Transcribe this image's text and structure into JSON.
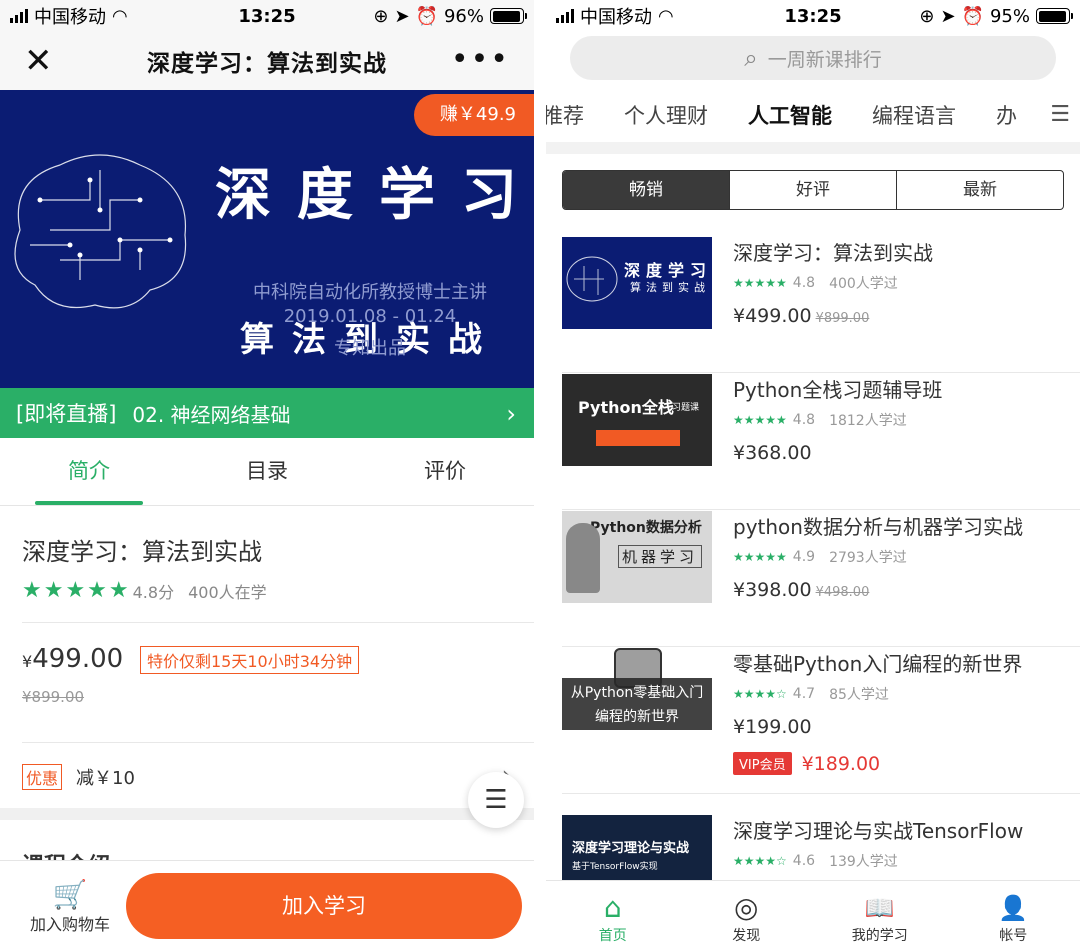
{
  "left": {
    "status": {
      "carrier": "中国移动",
      "time": "13:25",
      "battery": "96%",
      "battery_level": 0.96
    },
    "nav": {
      "close": "✕",
      "title": "深度学习：算法到实战",
      "more": "•••"
    },
    "banner": {
      "earn": "赚￥49.9",
      "title": "深度学习",
      "subtitle": "算法到实战",
      "line1": "中科院自动化所教授博士主讲",
      "line2": "2019.01.08 - 01.24",
      "line3": "专知出品"
    },
    "live": {
      "tag": "[即将直播]",
      "text": "02. 神经网络基础",
      "arrow": "›"
    },
    "tabs": [
      "简介",
      "目录",
      "评价"
    ],
    "info": {
      "title": "深度学习：算法到实战",
      "stars": "★★★★★",
      "score": "4.8分",
      "learners": "400人在学",
      "price_symbol": "¥",
      "price": "499.00",
      "limit": "特价仅剩15天10小时34分钟",
      "original": "¥899.00",
      "coupon_badge": "优惠",
      "coupon_text": "减￥10",
      "chevron": "›"
    },
    "intro_heading": "课程介绍",
    "fab_icon": "☰",
    "bottom": {
      "cart_icon": "🛒",
      "cart": "加入购物车",
      "join": "加入学习"
    }
  },
  "right": {
    "status": {
      "carrier": "中国移动",
      "time": "13:25",
      "battery": "95%",
      "battery_level": 0.95
    },
    "search": {
      "icon": "⌕",
      "placeholder": "一周新课排行"
    },
    "categories": [
      "推荐",
      "个人理财",
      "人工智能",
      "编程语言",
      "办"
    ],
    "menu_icon": "☰",
    "segments": [
      "畅销",
      "好评",
      "最新"
    ],
    "courses": [
      {
        "name": "深度学习：算法到实战",
        "stars": "★★★★★",
        "score": "4.8",
        "count": "400人学过",
        "price": "¥499.00",
        "old": "¥899.00",
        "thumb_title": "深度学习",
        "thumb_sub": "算法到实战"
      },
      {
        "name": "Python全栈习题辅导班",
        "stars": "★★★★★",
        "score": "4.8",
        "count": "1812人学过",
        "price": "¥368.00",
        "old": "",
        "thumb_title": "Python全栈",
        "thumb_sub": "习题课"
      },
      {
        "name": "python数据分析与机器学习实战",
        "stars": "★★★★★",
        "score": "4.9",
        "count": "2793人学过",
        "price": "¥398.00",
        "old": "¥498.00",
        "thumb_title": "Python数据分析",
        "thumb_sub": "机器学习"
      },
      {
        "name": "零基础Python入门编程的新世界",
        "stars": "★★★★☆",
        "score": "4.7",
        "count": "85人学过",
        "price": "¥199.00",
        "old": "",
        "vip_badge": "VIP会员",
        "vip_price": "¥189.00",
        "thumb_title": "从Python零基础入门",
        "thumb_sub": "编程的新世界"
      },
      {
        "name": "深度学习理论与实战TensorFlow",
        "stars": "★★★★☆",
        "score": "4.6",
        "count": "139人学过",
        "price": "",
        "old": "",
        "thumb_title": "深度学习理论与实战",
        "thumb_sub": "基于TensorFlow实现"
      }
    ],
    "tabbar": [
      {
        "icon": "⌂",
        "label": "首页"
      },
      {
        "icon": "◎",
        "label": "发现"
      },
      {
        "icon": "📖",
        "label": "我的学习"
      },
      {
        "icon": "👤",
        "label": "帐号"
      }
    ],
    "colors": {
      "accent": "#2aaf67",
      "orange": "#f55f23",
      "vip": "#e53935",
      "banner": "#0b1c73"
    }
  }
}
